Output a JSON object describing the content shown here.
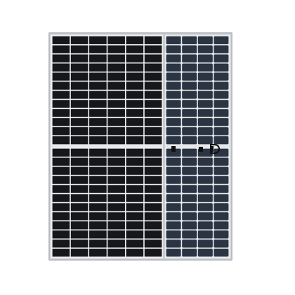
{
  "image": {
    "subject": "bifacial-half-cut-solar-panel",
    "views": [
      "front",
      "back"
    ],
    "colors": {
      "background": "#ffffff",
      "frame": "#b8bcc0",
      "front_cell": "#15171b",
      "front_gap": "#f2f2f2",
      "back_cell": "#2b3442",
      "back_gap": "#e9ecef",
      "junction_box": "#111111"
    }
  }
}
